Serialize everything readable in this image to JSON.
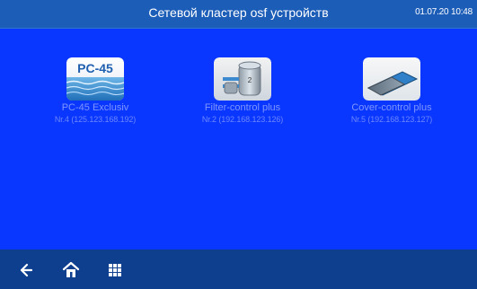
{
  "header": {
    "title": "Сетевой кластер osf устройств",
    "datetime": "01.07.20 10:48"
  },
  "devices": [
    {
      "name": "PC-45 Exclusiv",
      "address": "Nr.4 (125.123.168.192)",
      "icon": "pc45-icon",
      "icon_label": "PC-45"
    },
    {
      "name": "Filter-control plus",
      "address": "Nr.2 (192.168.123.126)",
      "icon": "filter-tank-icon",
      "icon_label": "2"
    },
    {
      "name": "Cover-control plus",
      "address": "Nr.5 (192.168.123.127)",
      "icon": "pool-cover-icon"
    }
  ],
  "footer": {
    "buttons": [
      "back-arrow-icon",
      "home-icon",
      "grid-menu-icon"
    ]
  },
  "colors": {
    "header_bg": "#1c5db8",
    "main_bg": "#0a37ff",
    "footer_bg": "#0e3f8f",
    "label_color": "#7f96ff"
  }
}
